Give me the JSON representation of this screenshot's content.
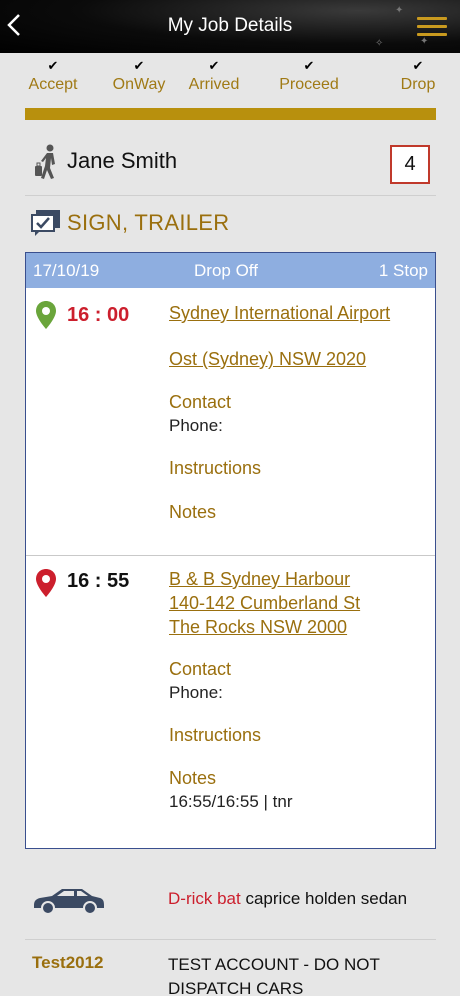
{
  "header": {
    "back_glyph": "<",
    "title": "My Job Details",
    "menu_icon": "hamburger-icon"
  },
  "steps": [
    {
      "label": "Accept",
      "done": true
    },
    {
      "label": "OnWay",
      "done": true
    },
    {
      "label": "Arrived",
      "done": true
    },
    {
      "label": "Proceed",
      "done": true
    },
    {
      "label": "Drop",
      "done": true
    }
  ],
  "progress": {
    "fraction": 1.0,
    "color": "#b8900d"
  },
  "passenger": {
    "name": "Jane Smith",
    "count": "4"
  },
  "sign": {
    "text": "SIGN, TRAILER"
  },
  "job": {
    "date": "17/10/19",
    "type": "Drop Off",
    "stops": "1 Stop",
    "pickup": {
      "time": "16 : 00",
      "address_line1": "Sydney International Airport",
      "address_line2": "Ost (Sydney) NSW 2020",
      "contact_label": "Contact",
      "phone_label": "Phone:",
      "instructions_label": "Instructions",
      "notes_label": "Notes"
    },
    "dropoff": {
      "time": "16 : 55",
      "address_line1": "B & B Sydney Harbour",
      "address_line2": "140-142 Cumberland St",
      "address_line3": "The Rocks NSW 2000",
      "contact_label": "Contact",
      "phone_label": "Phone:",
      "instructions_label": "Instructions",
      "notes_label": "Notes",
      "notes_value": "16:55/16:55 | tnr"
    }
  },
  "vehicle": {
    "driver": "D-rick bat",
    "description": "caprice holden sedan"
  },
  "account": {
    "code": "Test2012",
    "name": "TEST ACCOUNT - DO NOT DISPATCH CARS"
  },
  "colors": {
    "accent": "#9a6f0e",
    "header_blue": "#8eaee0",
    "pickup_pin": "#6aa53b",
    "dropoff_pin": "#cc1f2d"
  }
}
